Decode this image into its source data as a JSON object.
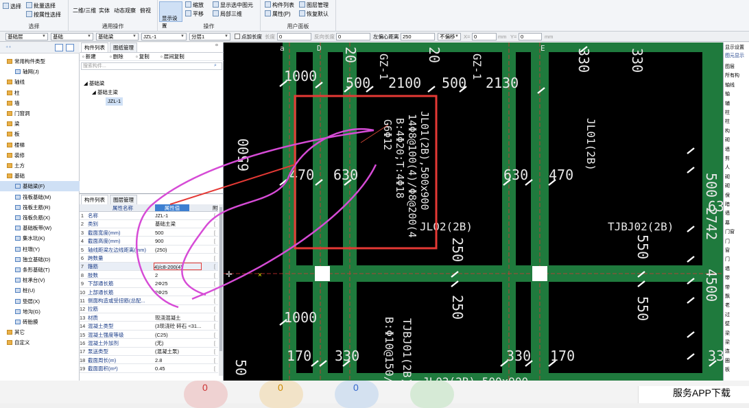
{
  "ribbon": {
    "groups": [
      {
        "caption": "选择",
        "buttons": [
          "选择",
          "批量选择",
          "按属性选择"
        ]
      },
      {
        "caption": "通用操作",
        "buttons": [
          "二维/三维",
          "俯视",
          "动态观察",
          "实体"
        ]
      },
      {
        "caption": "操作",
        "buttons": [
          "显示设置",
          "缩放",
          "平移",
          "显示选中图元",
          "局部三维"
        ]
      },
      {
        "caption": "用户面板",
        "buttons": [
          "构件列表",
          "图层管理",
          "属性(P)",
          "恢复默认"
        ]
      }
    ]
  },
  "toolbar": {
    "combos": [
      "基础层",
      "基础",
      "基础梁",
      "JZL-1",
      "分层1"
    ],
    "checkbox_label": "点加长度",
    "fields": [
      {
        "label": "长度",
        "value": "0"
      },
      {
        "label": "反向长度",
        "value": "0"
      },
      {
        "label": "左偏心距离",
        "value": "250"
      }
    ],
    "offset_combo": "不偏移",
    "x_label": "X=",
    "x_value": "0",
    "y_label": "Y=",
    "y_value": "0",
    "unit": "mm"
  },
  "left_tree": {
    "items": [
      {
        "label": "常用构件类型",
        "level": 0,
        "icon": "folder-icon"
      },
      {
        "label": "轴网(J)",
        "level": 1,
        "icon": "grid-icon"
      },
      {
        "label": "轴线",
        "level": 0,
        "icon": "folder-icon"
      },
      {
        "label": "柱",
        "level": 0,
        "icon": "folder-icon"
      },
      {
        "label": "墙",
        "level": 0,
        "icon": "folder-icon"
      },
      {
        "label": "门窗洞",
        "level": 0,
        "icon": "folder-icon"
      },
      {
        "label": "梁",
        "level": 0,
        "icon": "folder-icon"
      },
      {
        "label": "板",
        "level": 0,
        "icon": "folder-icon"
      },
      {
        "label": "楼梯",
        "level": 0,
        "icon": "folder-icon"
      },
      {
        "label": "装修",
        "level": 0,
        "icon": "folder-icon"
      },
      {
        "label": "土方",
        "level": 0,
        "icon": "folder-icon"
      },
      {
        "label": "基础",
        "level": 0,
        "icon": "folder-icon"
      },
      {
        "label": "基础梁(F)",
        "level": 1,
        "icon": "beam-icon",
        "selected": true
      },
      {
        "label": "筏板基础(M)",
        "level": 1,
        "icon": "raft-icon"
      },
      {
        "label": "筏板主筋(R)",
        "level": 1,
        "icon": "rebar-icon"
      },
      {
        "label": "筏板负筋(X)",
        "level": 1,
        "icon": "rebar-icon"
      },
      {
        "label": "基础板带(W)",
        "level": 1,
        "icon": "strip-icon"
      },
      {
        "label": "集水坑(K)",
        "level": 1,
        "icon": "pit-icon"
      },
      {
        "label": "柱墩(Y)",
        "level": 1,
        "icon": "pier-icon"
      },
      {
        "label": "独立基础(D)",
        "level": 1,
        "icon": "footing-icon"
      },
      {
        "label": "条形基础(T)",
        "level": 1,
        "icon": "strip-footing-icon"
      },
      {
        "label": "桩承台(V)",
        "level": 1,
        "icon": "pile-cap-icon"
      },
      {
        "label": "桩(U)",
        "level": 1,
        "icon": "pile-icon"
      },
      {
        "label": "垫层(X)",
        "level": 1,
        "icon": "cushion-icon"
      },
      {
        "label": "地沟(G)",
        "level": 1,
        "icon": "trench-icon"
      },
      {
        "label": "砖胎膜",
        "level": 1,
        "icon": "brick-icon"
      },
      {
        "label": "其它",
        "level": 0,
        "icon": "folder-icon"
      },
      {
        "label": "自定义",
        "level": 0,
        "icon": "folder-icon"
      }
    ]
  },
  "component_panel": {
    "tabs": [
      "构件列表",
      "图纸管理"
    ],
    "toolbar": [
      "新建",
      "删除",
      "复制",
      "层间复制"
    ],
    "search_placeholder": "搜索构件...",
    "tree": [
      "基础梁",
      "基础主梁",
      "JZL-1"
    ]
  },
  "property_panel": {
    "tabs": [
      "构件列表",
      "图层管理"
    ],
    "headers": [
      "属性名称",
      "属性值",
      "附"
    ],
    "rows": [
      {
        "n": "1",
        "k": "名称",
        "v": "JZL-1"
      },
      {
        "n": "2",
        "k": "类别",
        "v": "基础主梁"
      },
      {
        "n": "3",
        "k": "截面宽度(mm)",
        "v": "500"
      },
      {
        "n": "4",
        "k": "截面高度(mm)",
        "v": "900"
      },
      {
        "n": "5",
        "k": "轴线距梁左边线距离(mm)",
        "v": "(250)"
      },
      {
        "n": "6",
        "k": "跨数量",
        "v": ""
      },
      {
        "n": "7",
        "k": "箍筋",
        "v": "4)/c8-200(4)"
      },
      {
        "n": "8",
        "k": "肢数",
        "v": "2"
      },
      {
        "n": "9",
        "k": "下部通长筋",
        "v": "2Φ25"
      },
      {
        "n": "10",
        "k": "上部通长筋",
        "v": "2Φ25"
      },
      {
        "n": "11",
        "k": "侧面构造或受扭筋(总配...",
        "v": ""
      },
      {
        "n": "12",
        "k": "拉筋",
        "v": ""
      },
      {
        "n": "13",
        "k": "材质",
        "v": "现浇混凝土"
      },
      {
        "n": "14",
        "k": "混凝土类型",
        "v": "(3现浇砼 碎石 <31..."
      },
      {
        "n": "15",
        "k": "混凝土强度等级",
        "v": "(C25)"
      },
      {
        "n": "16",
        "k": "混凝土外加剂",
        "v": "(无)"
      },
      {
        "n": "17",
        "k": "泵送类型",
        "v": "(混凝土泵)"
      },
      {
        "n": "18",
        "k": "截面周长(m)",
        "v": "2.8"
      },
      {
        "n": "19",
        "k": "截面面积(m²)",
        "v": "0.45"
      }
    ]
  },
  "canvas": {
    "axis_labels": [
      "a",
      "D",
      "E"
    ],
    "dims": [
      "1000",
      "500",
      "2100",
      "500",
      "2130",
      "6500",
      "470",
      "630",
      "630",
      "470",
      "1000",
      "170",
      "330",
      "330",
      "170",
      "500",
      "2742",
      "4500",
      "550",
      "250",
      "330",
      "330",
      "63",
      "33",
      "50",
      "20",
      "20"
    ],
    "beam_labels": [
      "JL01(2B)",
      "JL02(2B)",
      "TJBJ02(2B)",
      "TJBJ01(2B)",
      "GZ-1",
      "JL02(2B) 500x900"
    ],
    "annotation_lines": [
      "JL01(2B),500x900",
      "14Φ8@100(4)/Φ8@200(4",
      "B:4Φ20;T:4Φ18",
      "G6Φ12"
    ],
    "rebar_note": "B:Φ10@150/"
  },
  "right_panel": {
    "title": "显示设置",
    "tab": "图元显示",
    "items": [
      "图层",
      "所有构",
      "轴线",
      "轴",
      "辅",
      "柱",
      "柱",
      "构",
      "砌",
      "墙",
      "剪",
      "人",
      "砌",
      "砌",
      "保",
      "暗",
      "墙",
      "幕",
      "门窗",
      "门",
      "窗",
      "门",
      "墙",
      "带",
      "带",
      "飘",
      "老",
      "过",
      "壁",
      "梁",
      "梁",
      "连",
      "圈",
      "板"
    ]
  },
  "bottom": {
    "badges": [
      "0",
      "0",
      "0"
    ],
    "banner": "服务APP下载"
  },
  "colors": {
    "beam": "#1f7a3d",
    "highlight": "#e53935",
    "markup": "#d64bd6",
    "canvas_bg": "#000000",
    "selection": "#cfe0f5"
  }
}
